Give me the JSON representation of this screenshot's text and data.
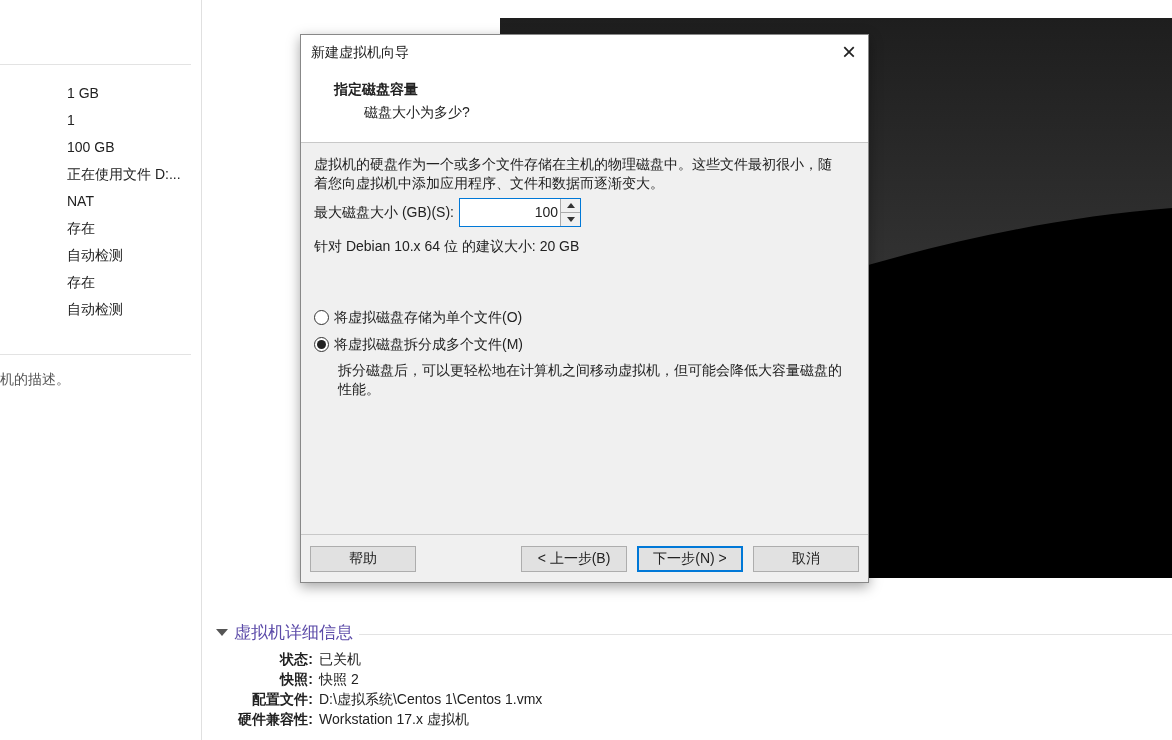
{
  "sidebar": {
    "values": [
      "1 GB",
      "1",
      "100 GB",
      "正在使用文件 D:...",
      "NAT",
      "存在",
      "自动检测",
      "存在",
      "自动检测"
    ],
    "description": "机的描述。"
  },
  "details": {
    "title": "虚拟机详细信息",
    "expanded": true,
    "rows": [
      {
        "label": "状态:",
        "value": "已关机"
      },
      {
        "label": "快照:",
        "value": "快照 2"
      },
      {
        "label": "配置文件:",
        "value": "D:\\虚拟系统\\Centos 1\\Centos 1.vmx"
      },
      {
        "label": "硬件兼容性:",
        "value": "Workstation 17.x 虚拟机"
      }
    ]
  },
  "dialog": {
    "title": "新建虚拟机向导",
    "close": "×",
    "heading": "指定磁盘容量",
    "subheading": "磁盘大小为多少?",
    "intro": "虚拟机的硬盘作为一个或多个文件存储在主机的物理磁盘中。这些文件最初很小，随着您向虚拟机中添加应用程序、文件和数据而逐渐变大。",
    "size_label": "最大磁盘大小 (GB)(S):",
    "size_value": "100",
    "recommendation": "针对 Debian 10.x 64 位 的建议大小: 20 GB",
    "options": [
      {
        "label": "将虚拟磁盘存储为单个文件(O)",
        "selected": false
      },
      {
        "label": "将虚拟磁盘拆分成多个文件(M)",
        "selected": true,
        "note": "拆分磁盘后，可以更轻松地在计算机之间移动虚拟机，但可能会降低大容量磁盘的性能。"
      }
    ],
    "buttons": [
      {
        "label": "帮助",
        "default": false
      },
      {
        "label": "< 上一步(B)",
        "default": false
      },
      {
        "label": "下一步(N) >",
        "default": true
      },
      {
        "label": "取消",
        "default": false
      }
    ]
  }
}
